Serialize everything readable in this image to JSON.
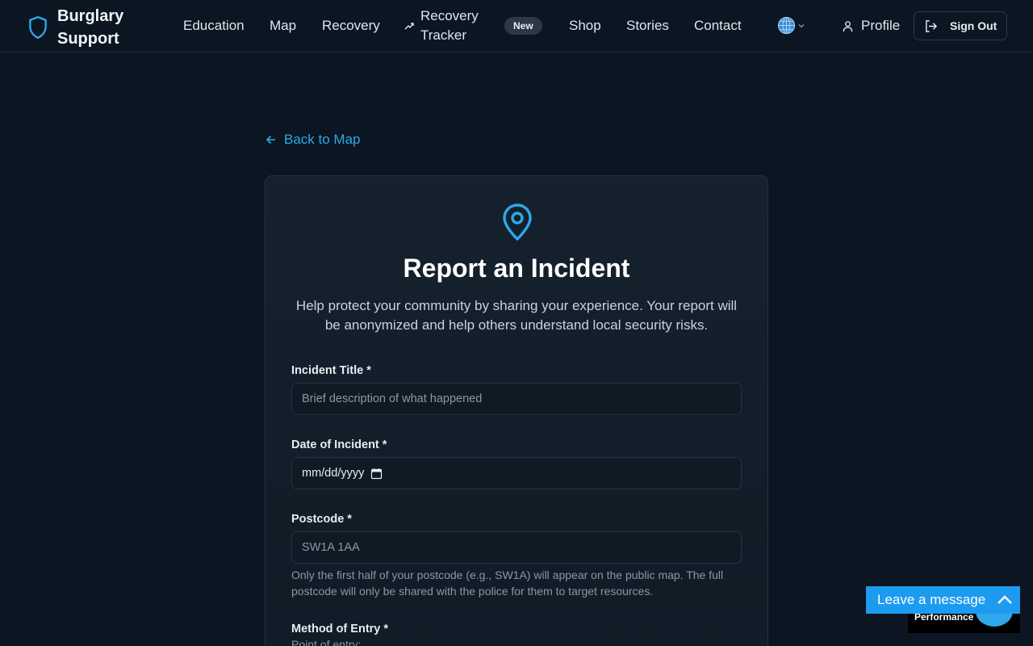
{
  "header": {
    "brand": "Burglary Support",
    "nav": [
      "Education",
      "Map",
      "Recovery",
      "Recovery Tracker",
      "Shop",
      "Stories",
      "Contact"
    ],
    "new_badge": "New",
    "language_icon": "globe-icon",
    "profile_label": "Profile",
    "signout_label": "Sign Out"
  },
  "back_link": "Back to Map",
  "form": {
    "title": "Report an Incident",
    "description": "Help protect your community by sharing your experience. Your report will be anonymized and help others understand local security risks.",
    "incident_title_label": "Incident Title *",
    "incident_title_placeholder": "Brief description of what happened",
    "date_label": "Date of Incident *",
    "date_placeholder": "mm/dd/yyyy",
    "postcode_label": "Postcode *",
    "postcode_placeholder": "SW1A 1AA",
    "postcode_help": "Only the first half of your postcode (e.g., SW1A) will appear on the public map. The full postcode will only be shared with the police for them to target resources.",
    "method_label": "Method of Entry *",
    "method_sublabel": "Point of entry:"
  },
  "chat": {
    "label": "Leave a message",
    "performance_label": "Performance"
  },
  "colors": {
    "accent": "#2ea8ea",
    "background": "#0b1622",
    "card": "#15212d"
  }
}
